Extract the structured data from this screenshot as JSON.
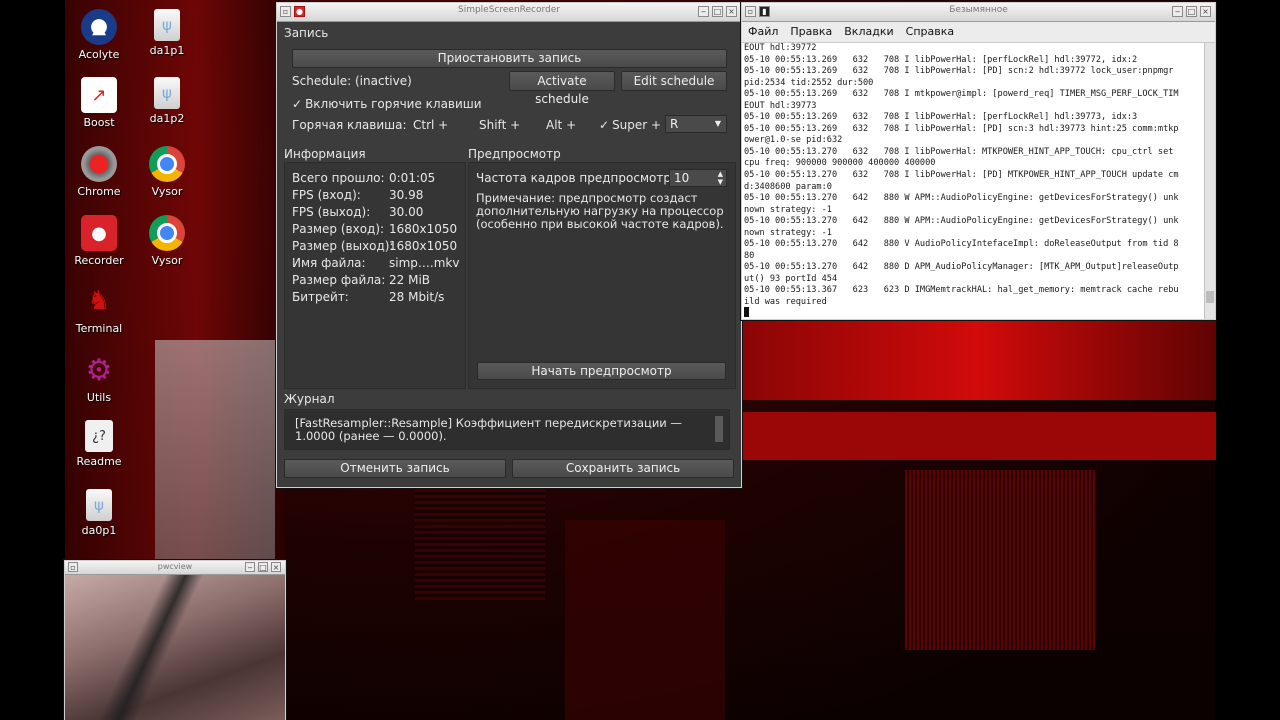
{
  "desktop": {
    "icons": [
      {
        "label": "Acolyte",
        "icon": "acolyte-icon"
      },
      {
        "label": "da1p1",
        "icon": "usb-drive-icon"
      },
      {
        "label": "Boost",
        "icon": "boost-icon"
      },
      {
        "label": "da1p2",
        "icon": "usb-drive-icon"
      },
      {
        "label": "Chrome",
        "icon": "chrome-red-icon"
      },
      {
        "label": "Vysor",
        "icon": "chrome-icon"
      },
      {
        "label": "Recorder",
        "icon": "recorder-icon"
      },
      {
        "label": "Vysor",
        "icon": "chrome-icon"
      },
      {
        "label": "Terminal",
        "icon": "terminal-devil-icon"
      },
      {
        "label": "Utils",
        "icon": "gear-icon"
      },
      {
        "label": "Readme",
        "icon": "readme-icon"
      },
      {
        "label": "da0p1",
        "icon": "usb-drive-icon"
      }
    ]
  },
  "ssr": {
    "title": "SimpleScreenRecorder",
    "section_record": "Запись",
    "pause_button": "Приостановить запись",
    "schedule_label": "Schedule: (inactive)",
    "activate_schedule": "Activate schedule",
    "edit_schedule": "Edit schedule",
    "hotkeys_enable": "Включить горячие клавиши",
    "hotkey_label": "Горячая клавиша:",
    "mod_ctrl": "Ctrl +",
    "mod_shift": "Shift +",
    "mod_alt": "Alt +",
    "mod_super": "Super +",
    "hotkey_key": "R",
    "info_title": "Информация",
    "info": [
      {
        "k": "Всего прошло:",
        "v": "0:01:05"
      },
      {
        "k": "FPS (вход):",
        "v": "30.98"
      },
      {
        "k": "FPS (выход):",
        "v": "30.00"
      },
      {
        "k": "Размер (вход):",
        "v": "1680x1050"
      },
      {
        "k": "Размер (выход):",
        "v": "1680x1050"
      },
      {
        "k": "Имя файла:",
        "v": "simp….mkv"
      },
      {
        "k": "Размер файла:",
        "v": "22 MiB"
      },
      {
        "k": "Битрейт:",
        "v": "28 Mbit/s"
      }
    ],
    "preview_title": "Предпросмотр",
    "preview_fps_label": "Частота кадров предпросмотра:",
    "preview_fps_value": "10",
    "preview_note": "Примечание: предпросмотр создаст дополнительную нагрузку на процессор (особенно при высокой частоте кадров).",
    "start_preview": "Начать предпросмотр",
    "log_title": "Журнал",
    "log_text": "[FastResampler::Resample] Коэффициент передискретизации — 1.0000 (ранее — 0.0000).",
    "cancel_button": "Отменить запись",
    "save_button": "Сохранить запись"
  },
  "terminal": {
    "title": "Безымянное",
    "menu": [
      "Файл",
      "Правка",
      "Вкладки",
      "Справка"
    ],
    "output": "EOUT hdl:39772\n05-10 00:55:13.269   632   708 I libPowerHal: [perfLockRel] hdl:39772, idx:2\n05-10 00:55:13.269   632   708 I libPowerHal: [PD] scn:2 hdl:39772 lock_user:pnpmgr\npid:2534 tid:2552 dur:500\n05-10 00:55:13.269   632   708 I mtkpower@impl: [powerd_req] TIMER_MSG_PERF_LOCK_TIM\nEOUT hdl:39773\n05-10 00:55:13.269   632   708 I libPowerHal: [perfLockRel] hdl:39773, idx:3\n05-10 00:55:13.269   632   708 I libPowerHal: [PD] scn:3 hdl:39773 hint:25 comm:mtkp\nower@1.0-se pid:632\n05-10 00:55:13.270   632   708 I libPowerHal: MTKPOWER_HINT_APP_TOUCH: cpu_ctrl set\ncpu freq: 900000 900000 400000 400000\n05-10 00:55:13.270   632   708 I libPowerHal: [PD] MTKPOWER_HINT_APP_TOUCH update cm\nd:3408600 param:0\n05-10 00:55:13.270   642   880 W APM::AudioPolicyEngine: getDevicesForStrategy() unk\nnown strategy: -1\n05-10 00:55:13.270   642   880 W APM::AudioPolicyEngine: getDevicesForStrategy() unk\nnown strategy: -1\n05-10 00:55:13.270   642   880 V AudioPolicyIntefaceImpl: doReleaseOutput from tid 8\n80\n05-10 00:55:13.270   642   880 D APM_AudioPolicyManager: [MTK_APM_Output]releaseOutp\nut() 93 portId 454\n05-10 00:55:13.367   623   623 D IMGMemtrackHAL: hal_get_memory: memtrack cache rebu\nild was required"
  },
  "pwcview": {
    "title": "pwcview"
  }
}
